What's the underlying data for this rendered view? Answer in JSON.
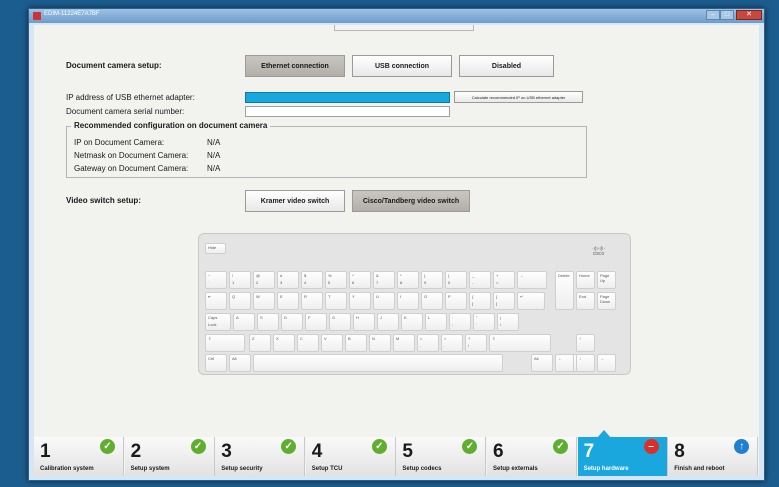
{
  "window": {
    "title": "EDIM-11224E7A7BF"
  },
  "camera": {
    "label": "Document camera setup:",
    "buttons": [
      "Ethernet connection",
      "USB connection",
      "Disabled"
    ],
    "ip_label": "IP address of USB ethernet adapter:",
    "calc_button": "Calculate recommended IP on USB ethernet adapter",
    "serial_label": "Document camera serial number:"
  },
  "recommended": {
    "title": "Recommended configuration on document camera",
    "rows": [
      {
        "label": "IP on Document Camera:",
        "value": "N/A"
      },
      {
        "label": "Netmask on Document Camera:",
        "value": "N/A"
      },
      {
        "label": "Gateway on Document Camera:",
        "value": "N/A"
      }
    ]
  },
  "video": {
    "label": "Video switch setup:",
    "buttons": [
      "Kramer video switch",
      "Cisco/Tandberg video switch"
    ]
  },
  "keyboard": {
    "brand_line1": "·ı|ı·ı|ı·",
    "brand_line2": "cisco",
    "hide": "Hide",
    "row1": [
      [
        "~",
        "`"
      ],
      [
        "!",
        "1"
      ],
      [
        "@",
        "2"
      ],
      [
        "#",
        "3"
      ],
      [
        "$",
        "4"
      ],
      [
        "%",
        "5"
      ],
      [
        "^",
        "6"
      ],
      [
        "&",
        "7"
      ],
      [
        "*",
        "8"
      ],
      [
        "(",
        "9"
      ],
      [
        ")",
        "0"
      ],
      [
        "_",
        "-"
      ],
      [
        "+",
        "="
      ],
      [
        "←",
        ""
      ]
    ],
    "row2": [
      [
        "⇤",
        ""
      ],
      [
        "Q",
        ""
      ],
      [
        "W",
        ""
      ],
      [
        "E",
        ""
      ],
      [
        "R",
        ""
      ],
      [
        "T",
        ""
      ],
      [
        "Y",
        ""
      ],
      [
        "U",
        ""
      ],
      [
        "I",
        ""
      ],
      [
        "O",
        ""
      ],
      [
        "P",
        ""
      ],
      [
        "{",
        "["
      ],
      [
        "}",
        "]"
      ],
      [
        "↵",
        ""
      ]
    ],
    "row3": [
      [
        "Caps",
        "Lock"
      ],
      [
        "A",
        ""
      ],
      [
        "S",
        ""
      ],
      [
        "D",
        ""
      ],
      [
        "F",
        ""
      ],
      [
        "G",
        ""
      ],
      [
        "H",
        ""
      ],
      [
        "J",
        ""
      ],
      [
        "K",
        ""
      ],
      [
        "L",
        ""
      ],
      [
        ":",
        ";"
      ],
      [
        "\"",
        "'"
      ],
      [
        "|",
        "\\"
      ]
    ],
    "row4": [
      [
        "⇧",
        ""
      ],
      [
        "Z",
        ""
      ],
      [
        "X",
        ""
      ],
      [
        "C",
        ""
      ],
      [
        "V",
        ""
      ],
      [
        "B",
        ""
      ],
      [
        "N",
        ""
      ],
      [
        "M",
        ""
      ],
      [
        "<",
        ","
      ],
      [
        ">",
        "."
      ],
      [
        "?",
        "/"
      ],
      [
        "⇧",
        ""
      ]
    ],
    "row5": [
      "Ctrl",
      "Alt",
      "",
      "Alt",
      "Ctrl"
    ],
    "nav": [
      "Delete",
      "Home",
      "Page Up",
      "End",
      "Page Down"
    ],
    "arrows": [
      "↑",
      "←",
      "↓",
      "→"
    ]
  },
  "steps": [
    {
      "num": "1",
      "name": "Calibration system",
      "status": "check"
    },
    {
      "num": "2",
      "name": "Setup system",
      "status": "check"
    },
    {
      "num": "3",
      "name": "Setup security",
      "status": "check"
    },
    {
      "num": "4",
      "name": "Setup TCU",
      "status": "check"
    },
    {
      "num": "5",
      "name": "Setup codecs",
      "status": "check"
    },
    {
      "num": "6",
      "name": "Setup externals",
      "status": "check"
    },
    {
      "num": "7",
      "name": "Setup hardware",
      "status": "stop"
    },
    {
      "num": "8",
      "name": "Finish and reboot",
      "status": "up"
    }
  ],
  "colors": {
    "accent": "#1aa7dd",
    "ok": "#5fae2f",
    "error": "#d8312b"
  }
}
